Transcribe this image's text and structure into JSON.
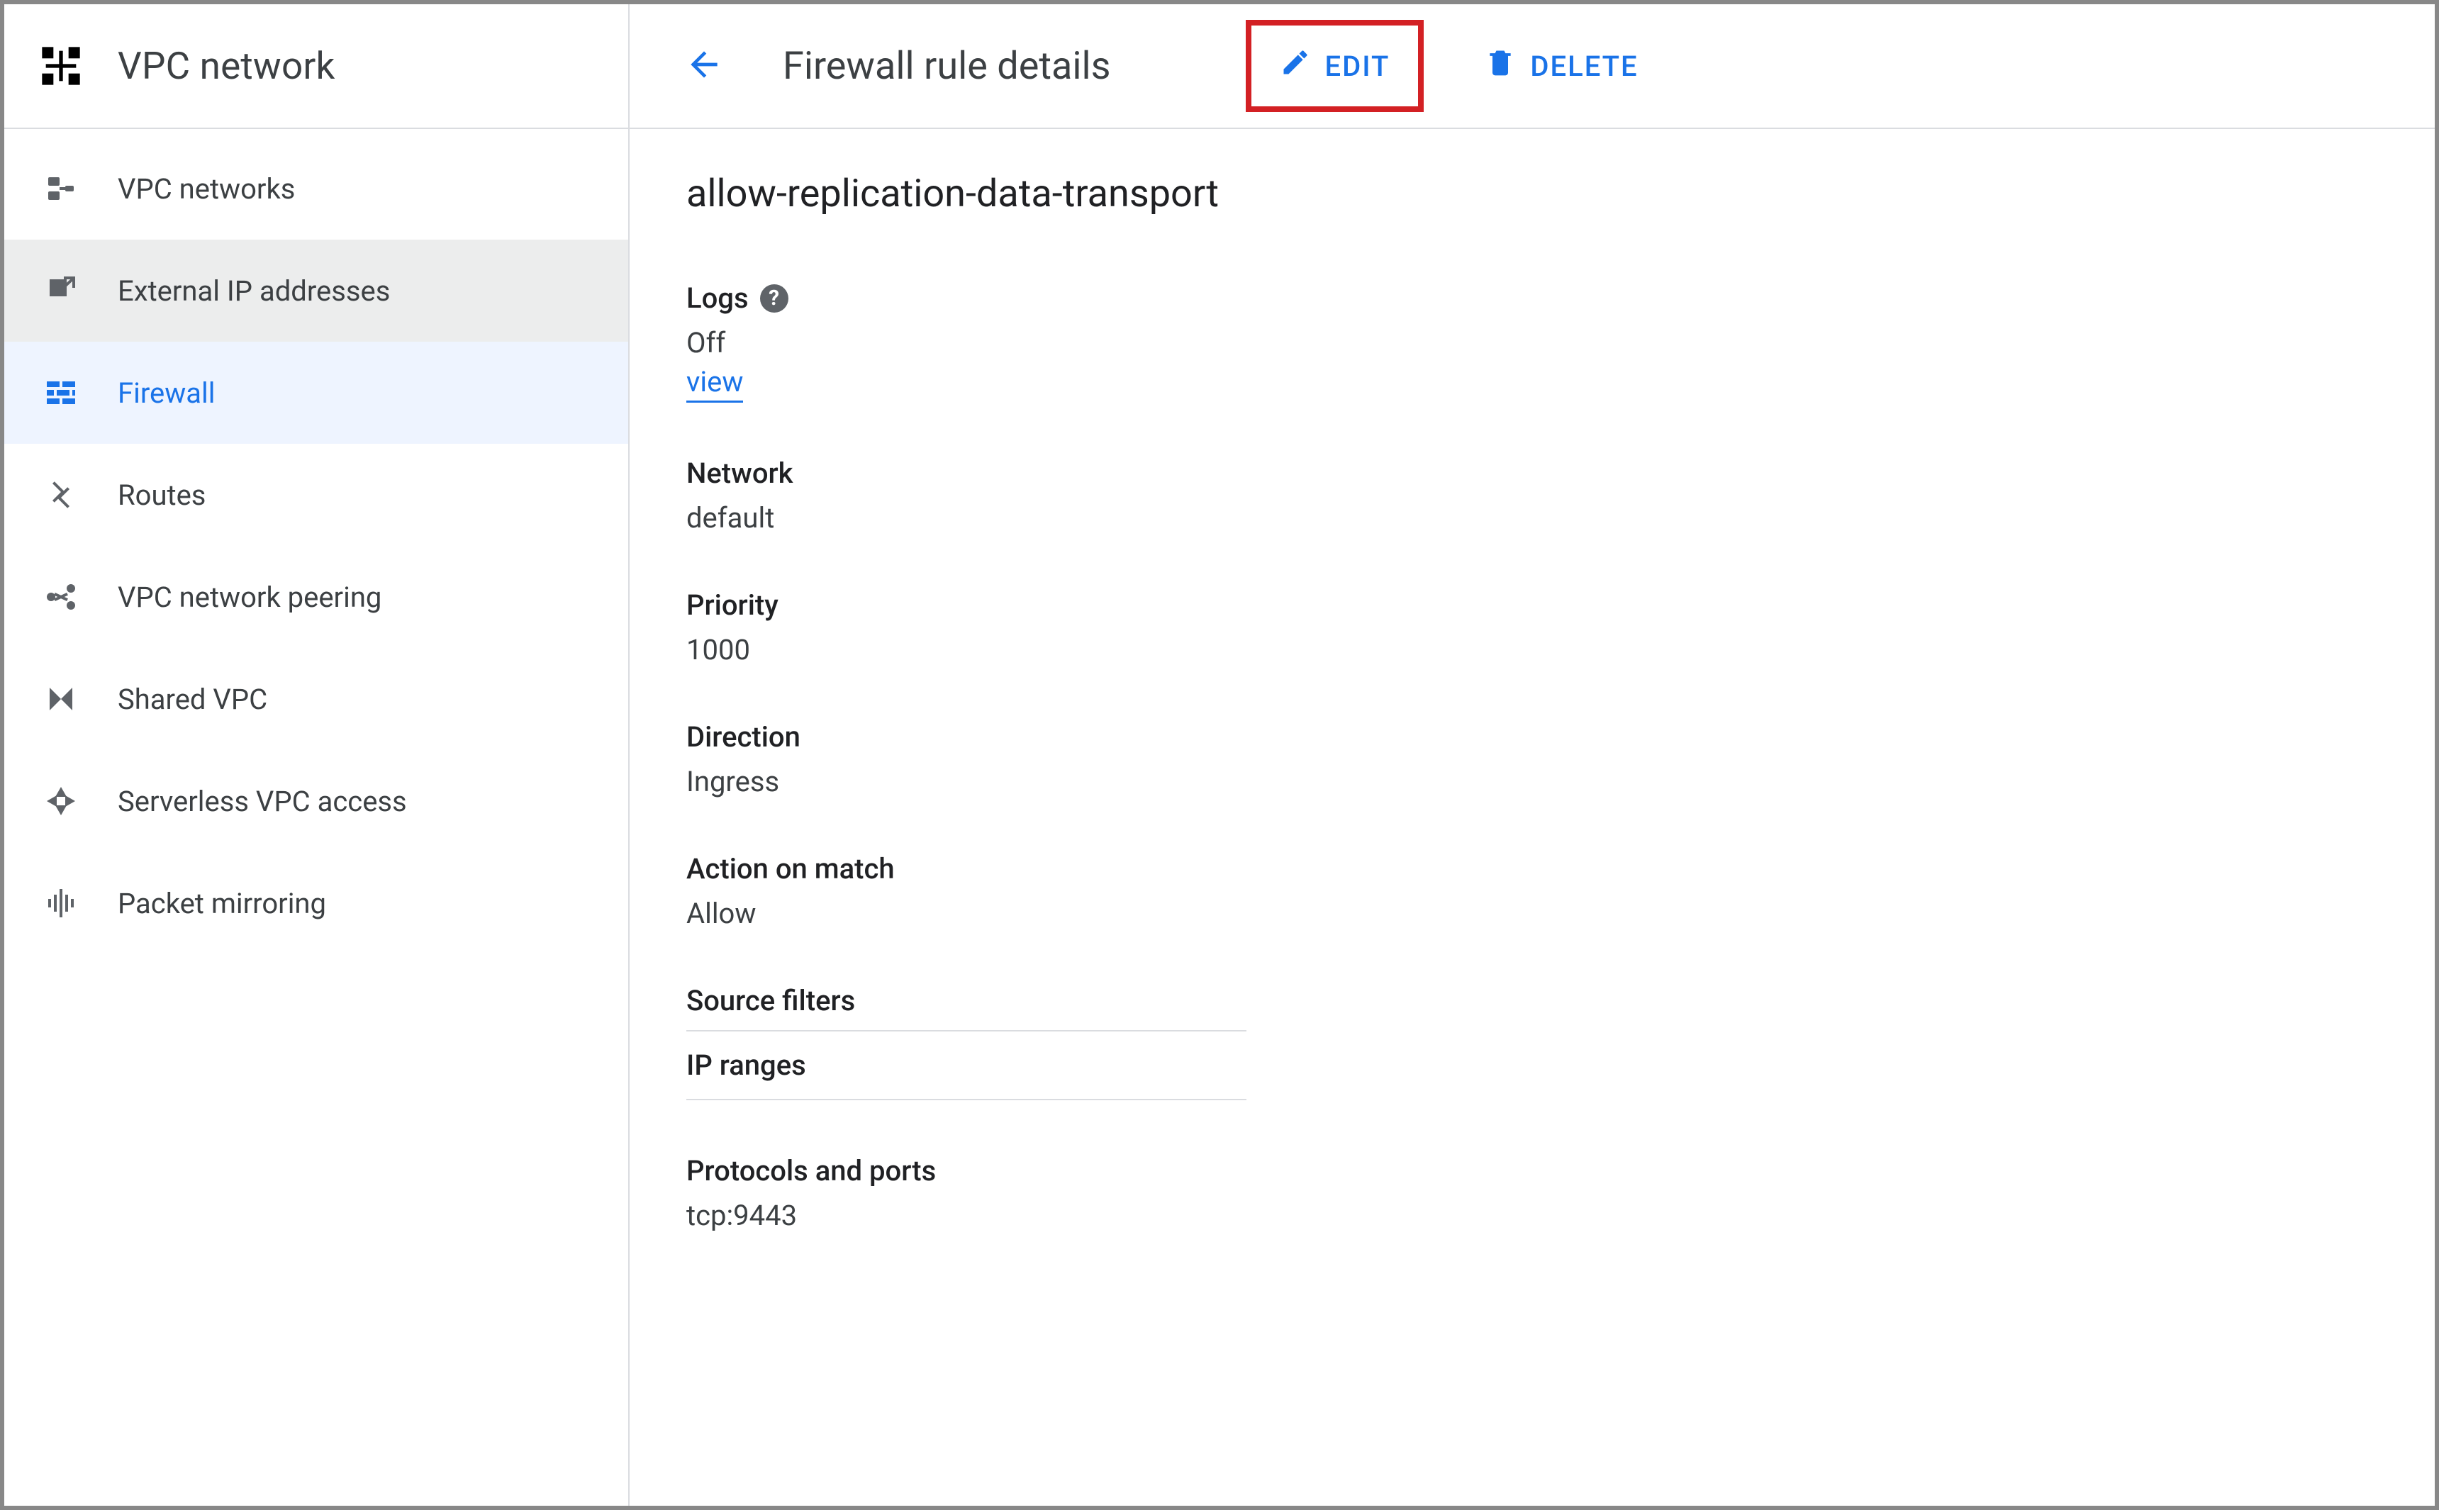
{
  "sidebar": {
    "title": "VPC network",
    "items": [
      {
        "label": "VPC networks",
        "icon": "vpc-networks-icon"
      },
      {
        "label": "External IP addresses",
        "icon": "external-ip-icon"
      },
      {
        "label": "Firewall",
        "icon": "firewall-icon"
      },
      {
        "label": "Routes",
        "icon": "routes-icon"
      },
      {
        "label": "VPC network peering",
        "icon": "peering-icon"
      },
      {
        "label": "Shared VPC",
        "icon": "shared-vpc-icon"
      },
      {
        "label": "Serverless VPC access",
        "icon": "serverless-icon"
      },
      {
        "label": "Packet mirroring",
        "icon": "mirroring-icon"
      }
    ],
    "active_index": 2,
    "hover_index": 1
  },
  "toolbar": {
    "page_title": "Firewall rule details",
    "edit_label": "EDIT",
    "delete_label": "DELETE"
  },
  "rule": {
    "name": "allow-replication-data-transport",
    "logs_label": "Logs",
    "logs_value": "Off",
    "logs_link": "view",
    "network_label": "Network",
    "network_value": "default",
    "priority_label": "Priority",
    "priority_value": "1000",
    "direction_label": "Direction",
    "direction_value": "Ingress",
    "action_label": "Action on match",
    "action_value": "Allow",
    "source_filters_label": "Source filters",
    "ip_ranges_label": "IP ranges",
    "protocols_label": "Protocols and ports",
    "protocols_value": "tcp:9443"
  }
}
